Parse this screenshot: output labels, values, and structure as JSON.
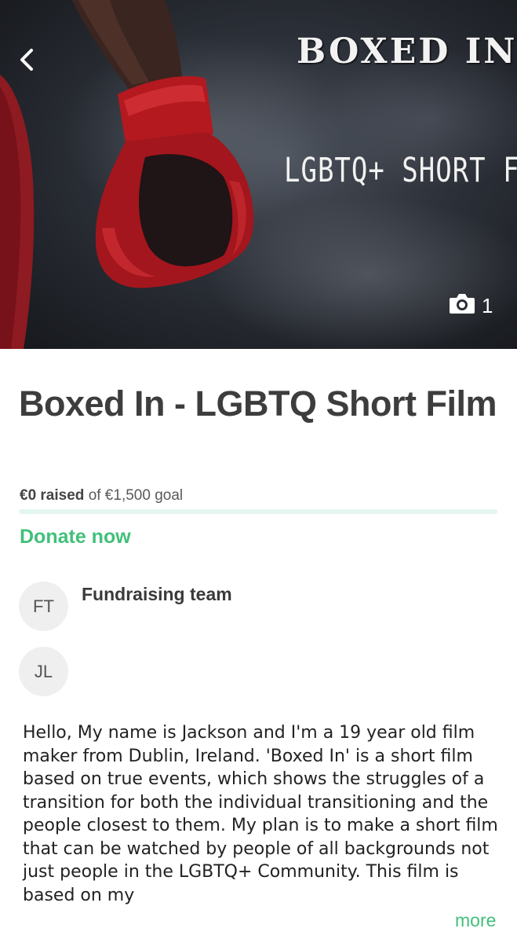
{
  "hero": {
    "poster_title": "BOXED IN",
    "poster_subtitle": "LGBTQ+ SHORT FIL",
    "photo_count": "1",
    "icons": {
      "back": "chevron-left-icon",
      "camera": "camera-icon"
    }
  },
  "campaign": {
    "title": "Boxed In - LGBTQ Short Film",
    "raised_amount": "€0 raised",
    "goal_text": "of €1,500 goal",
    "progress_fraction": 0,
    "donate_label": "Donate now"
  },
  "team": {
    "label": "Fundraising team",
    "members": [
      {
        "initials": "FT"
      },
      {
        "initials": "JL"
      }
    ]
  },
  "story": {
    "text": "Hello, My name is Jackson and I'm a 19 year old film maker from Dublin, Ireland. 'Boxed In' is a short film based on true events, which shows the struggles of a transition for both the individual transitioning and the people closest to them. My plan is to make a short film that can be watched by people of all backgrounds not just people in the LGBTQ+ Community. This film is based on my",
    "more_label": "more"
  },
  "colors": {
    "accent": "#41c07b",
    "progress_track": "#e3f6ee",
    "glove_red": "#b3191f",
    "title_text": "#3d3d3d"
  }
}
